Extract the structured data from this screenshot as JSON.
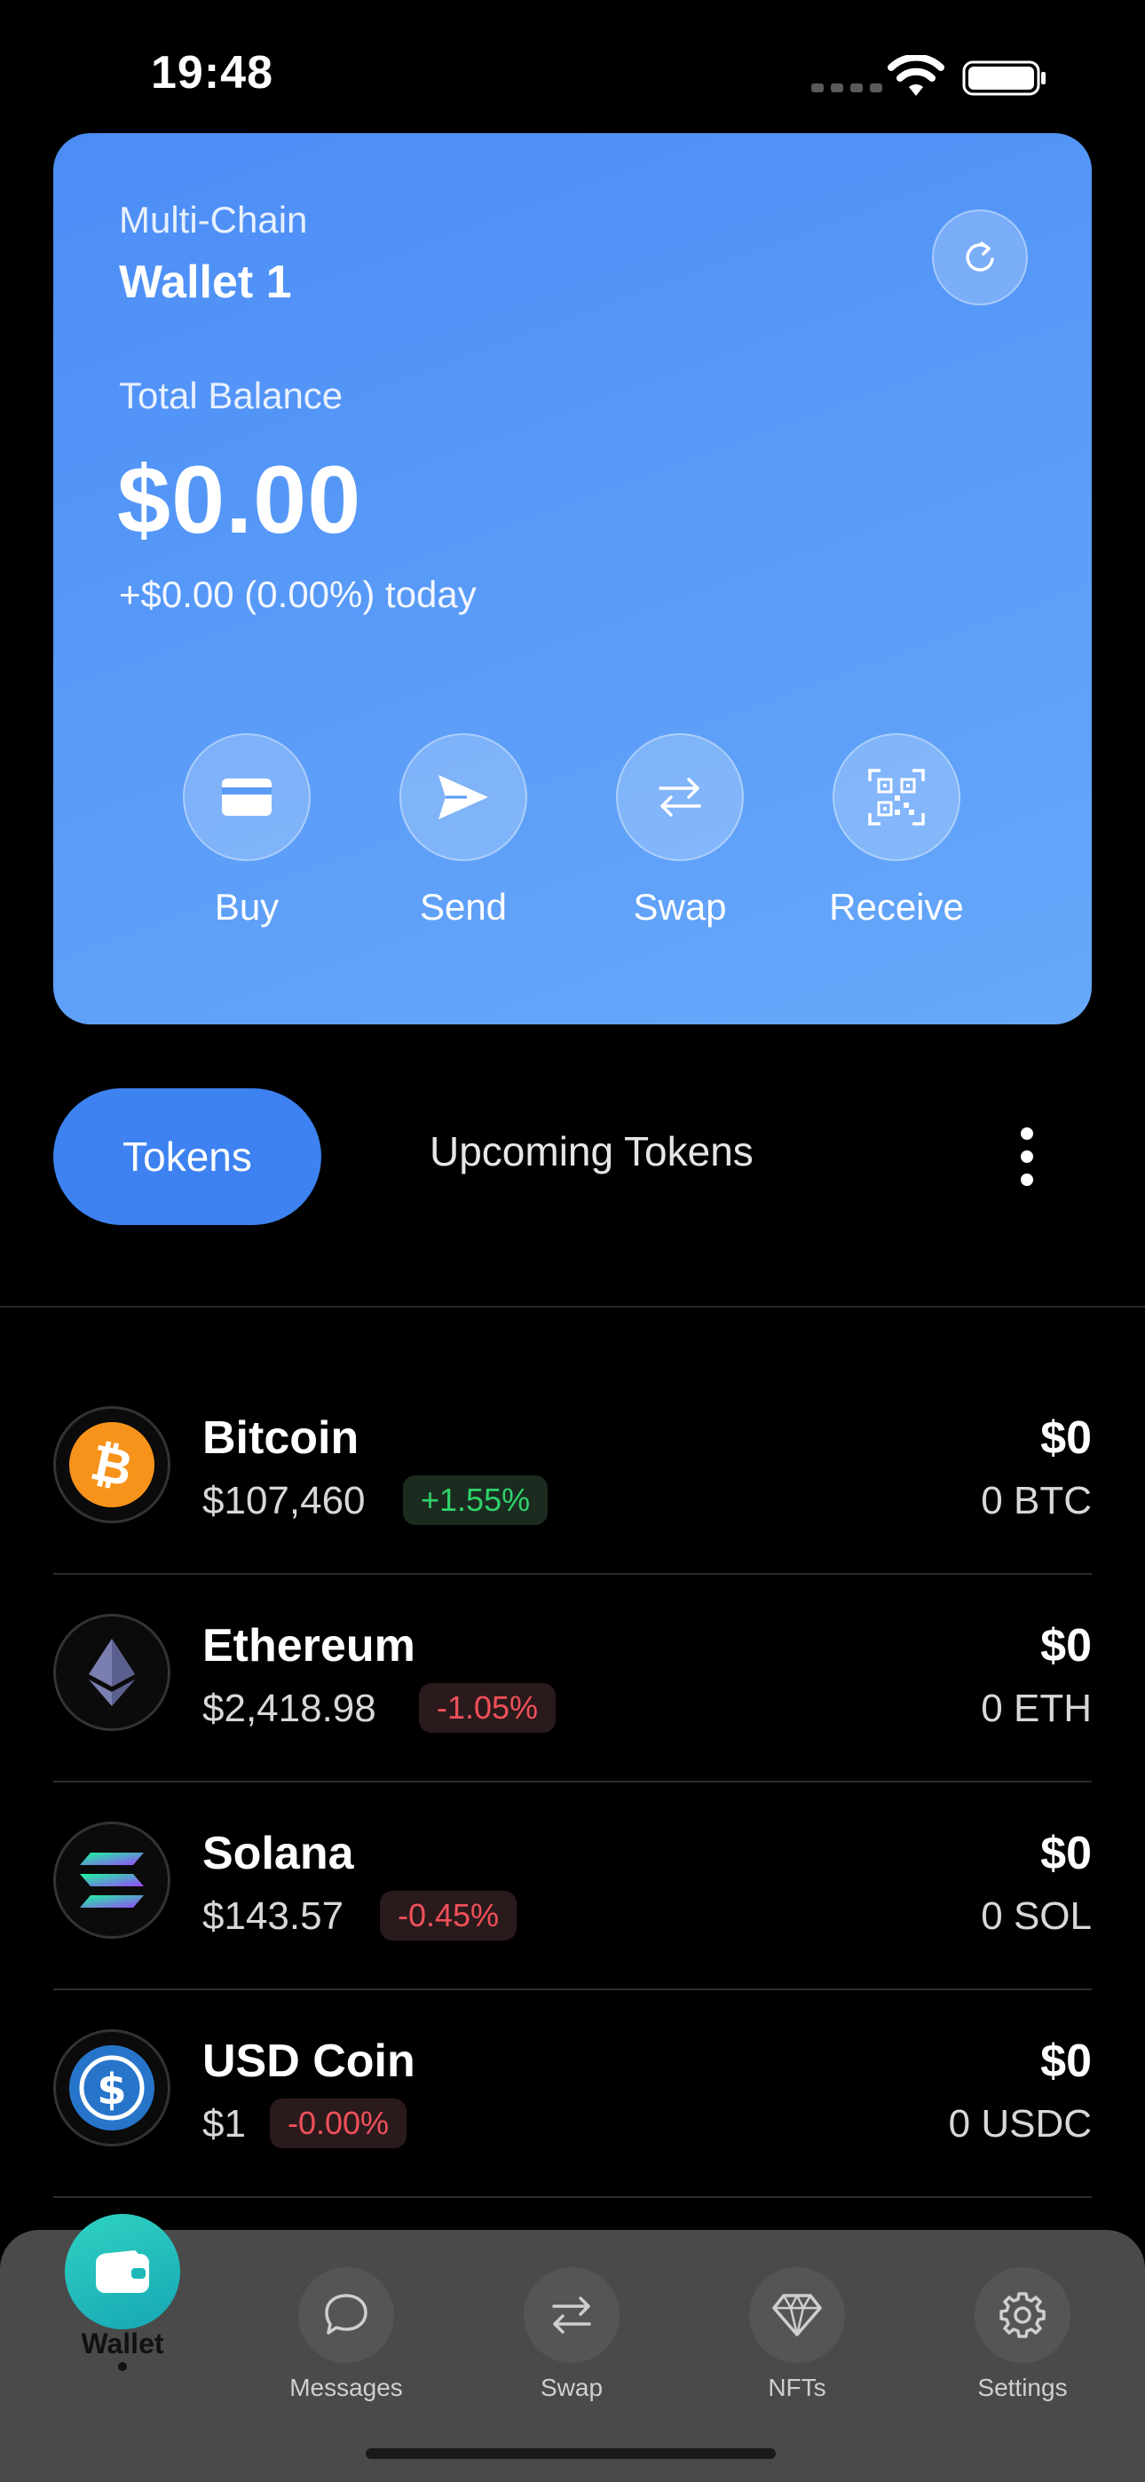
{
  "status_bar": {
    "time": "19:48"
  },
  "wallet": {
    "chain_label": "Multi-Chain",
    "name": "Wallet 1",
    "balance_label": "Total Balance",
    "balance": "$0.00",
    "change": "+$0.00 (0.00%) today",
    "actions": [
      {
        "label": "Buy",
        "icon": "card-icon"
      },
      {
        "label": "Send",
        "icon": "send-icon"
      },
      {
        "label": "Swap",
        "icon": "swap-icon"
      },
      {
        "label": "Receive",
        "icon": "qr-code-icon"
      }
    ]
  },
  "tabs": {
    "active": "Tokens",
    "inactive": "Upcoming Tokens"
  },
  "tokens": [
    {
      "name": "Bitcoin",
      "price": "$107,460",
      "change": "+1.55%",
      "direction": "up",
      "value": "$0",
      "amount": "0 BTC",
      "icon": "bitcoin-icon",
      "color": "#f7931a"
    },
    {
      "name": "Ethereum",
      "price": "$2,418.98",
      "change": "-1.05%",
      "direction": "down",
      "value": "$0",
      "amount": "0 ETH",
      "icon": "ethereum-icon",
      "color": "#627eea"
    },
    {
      "name": "Solana",
      "price": "$143.57",
      "change": "-0.45%",
      "direction": "down",
      "value": "$0",
      "amount": "0 SOL",
      "icon": "solana-icon",
      "color": "#9945ff"
    },
    {
      "name": "USD Coin",
      "price": "$1",
      "change": "-0.00%",
      "direction": "down",
      "value": "$0",
      "amount": "0 USDC",
      "icon": "usdc-icon",
      "color": "#2775ca"
    }
  ],
  "nav": [
    {
      "label": "Wallet",
      "icon": "wallet-icon",
      "active": true
    },
    {
      "label": "Messages",
      "icon": "chat-bubble-icon",
      "active": false
    },
    {
      "label": "Swap",
      "icon": "swap-icon",
      "active": false
    },
    {
      "label": "NFTs",
      "icon": "diamond-icon",
      "active": false
    },
    {
      "label": "Settings",
      "icon": "gear-icon",
      "active": false
    }
  ]
}
